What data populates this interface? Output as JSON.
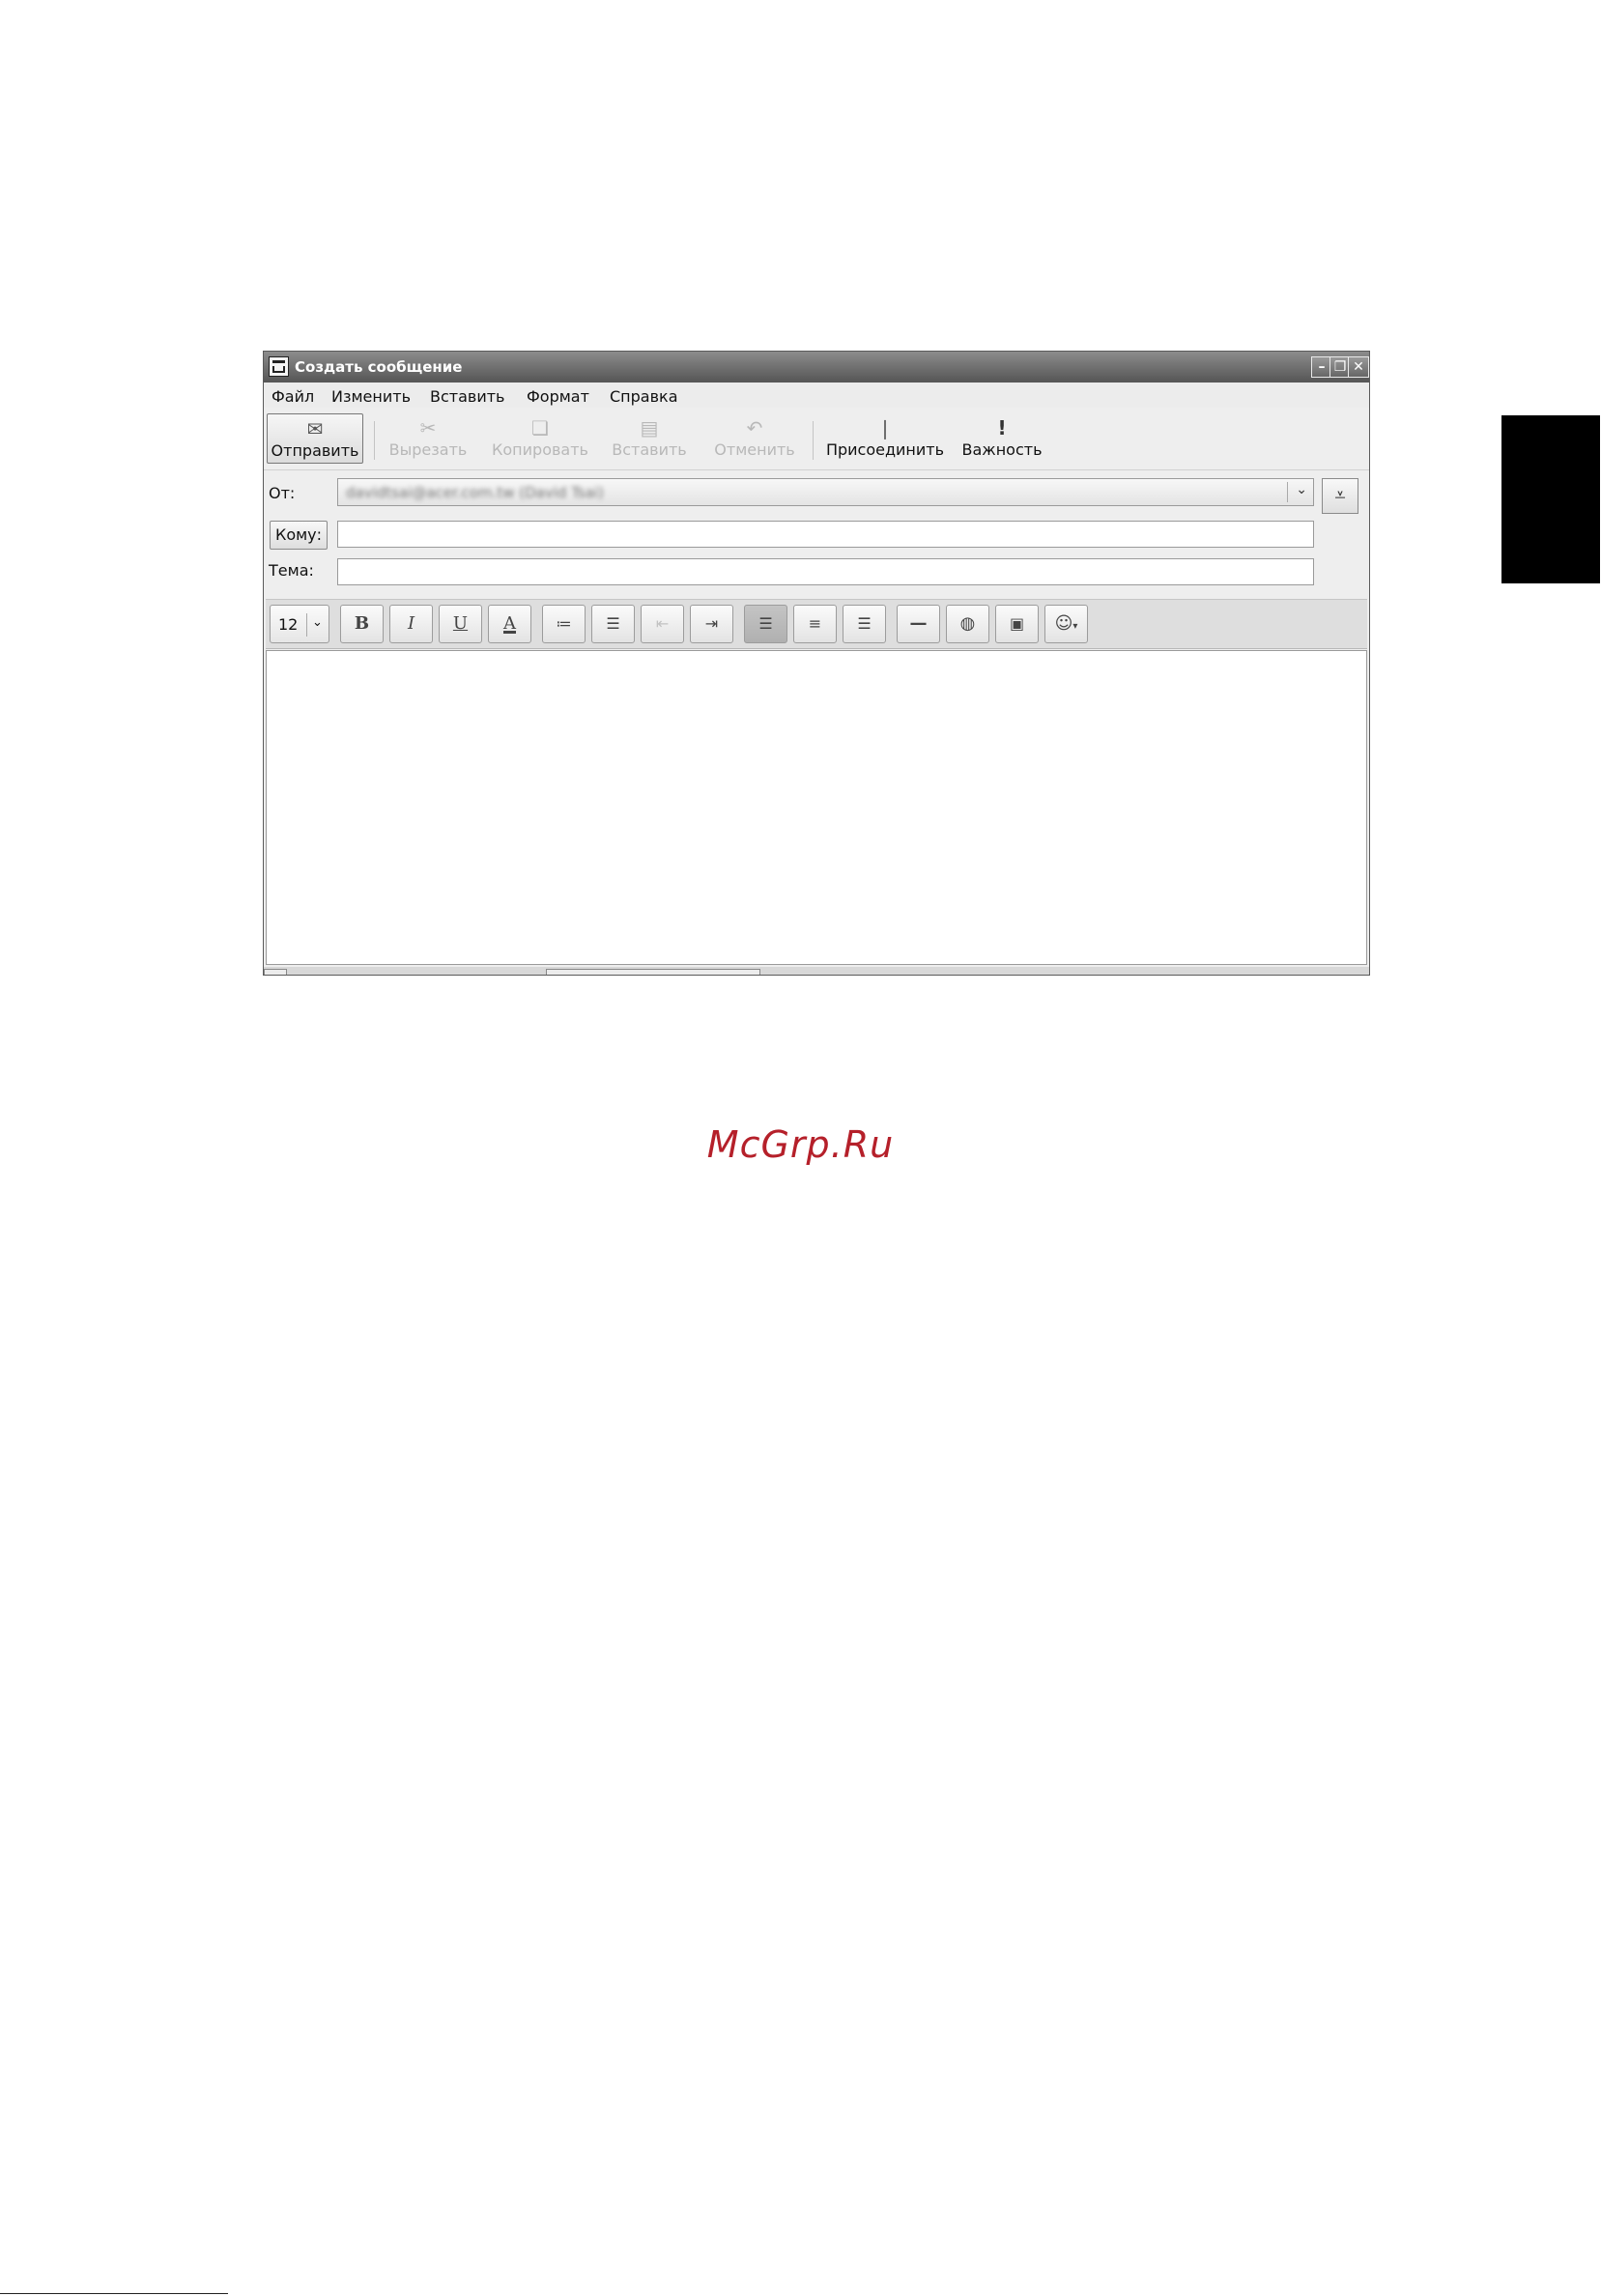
{
  "window": {
    "title": "Создать сообщение"
  },
  "menu": {
    "items": [
      "Файл",
      "Изменить",
      "Вставить",
      "Формат",
      "Справка"
    ]
  },
  "toolbar": {
    "send": "Отправить",
    "cut": "Вырезать",
    "copy": "Копировать",
    "paste": "Вставить",
    "undo": "Отменить",
    "attach": "Присоединить",
    "priority": "Важность"
  },
  "header": {
    "from_label": "От:",
    "from_value": "davidtsai@acer.com.tw (David Tsai)",
    "to_button": "Кому:",
    "to_value": "",
    "subject_label": "Тема:",
    "subject_value": ""
  },
  "format": {
    "font_size": "12",
    "bold": "B",
    "italic": "I",
    "underline": "U",
    "color": "A"
  },
  "page": {
    "watermark": "McGrp.Ru"
  },
  "colors": {
    "watermark": "#b5202a",
    "side_tab": "#000000"
  }
}
